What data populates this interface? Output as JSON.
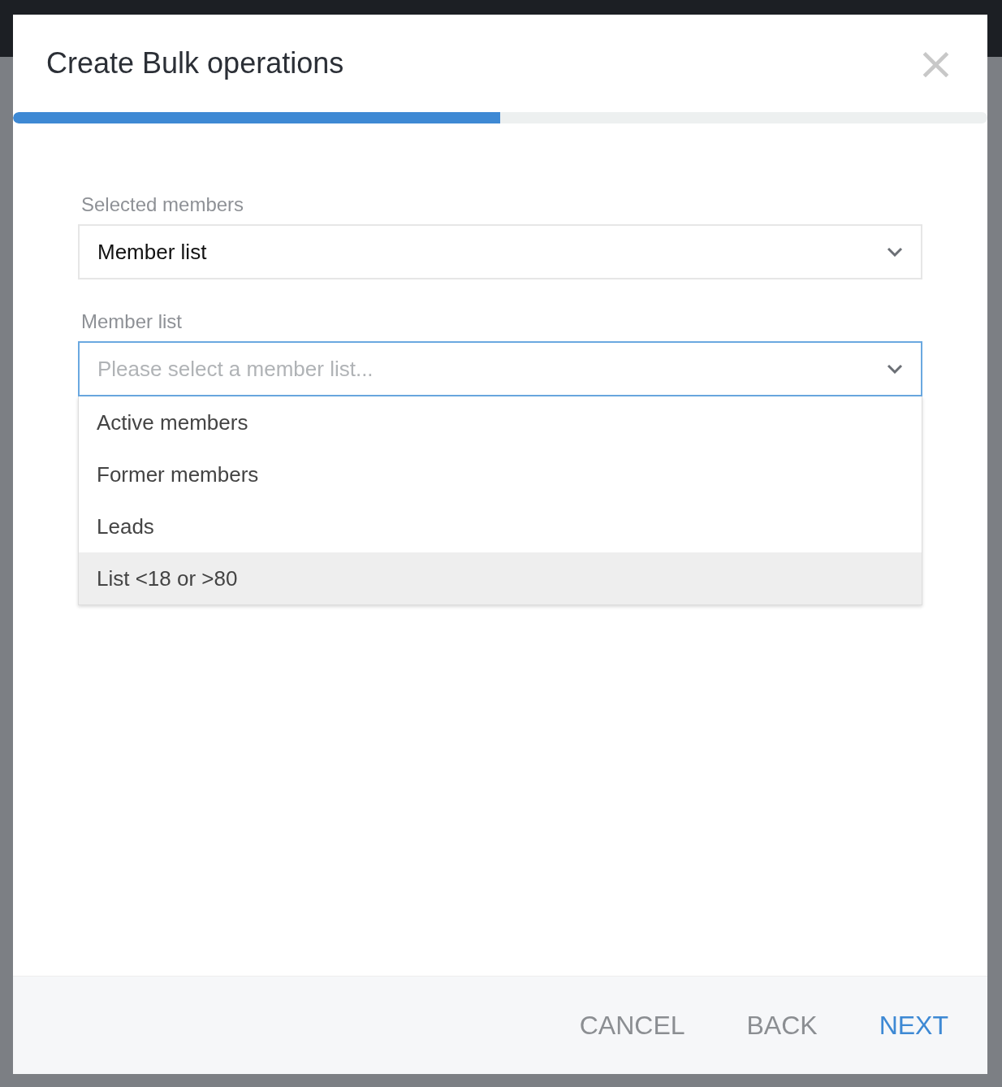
{
  "dialog": {
    "title": "Create Bulk operations",
    "close": "×"
  },
  "progress": {
    "level": 0.5
  },
  "fields": [
    {
      "label": "Selected members",
      "value": "Member list",
      "focused": false
    },
    {
      "label": "Member list",
      "placeholder": "Please select a member list...",
      "focused": true
    }
  ],
  "options": [
    {
      "label": "Active members",
      "selected": false
    },
    {
      "label": "Former members",
      "selected": false
    },
    {
      "label": "Leads",
      "selected": false
    },
    {
      "label": "List <18 or >80",
      "selected": true
    }
  ],
  "buttons": [
    {
      "label": "CANCEL",
      "kind": "secondary"
    },
    {
      "label": "BACK",
      "kind": "secondary"
    },
    {
      "label": "NEXT",
      "kind": "primary"
    }
  ]
}
